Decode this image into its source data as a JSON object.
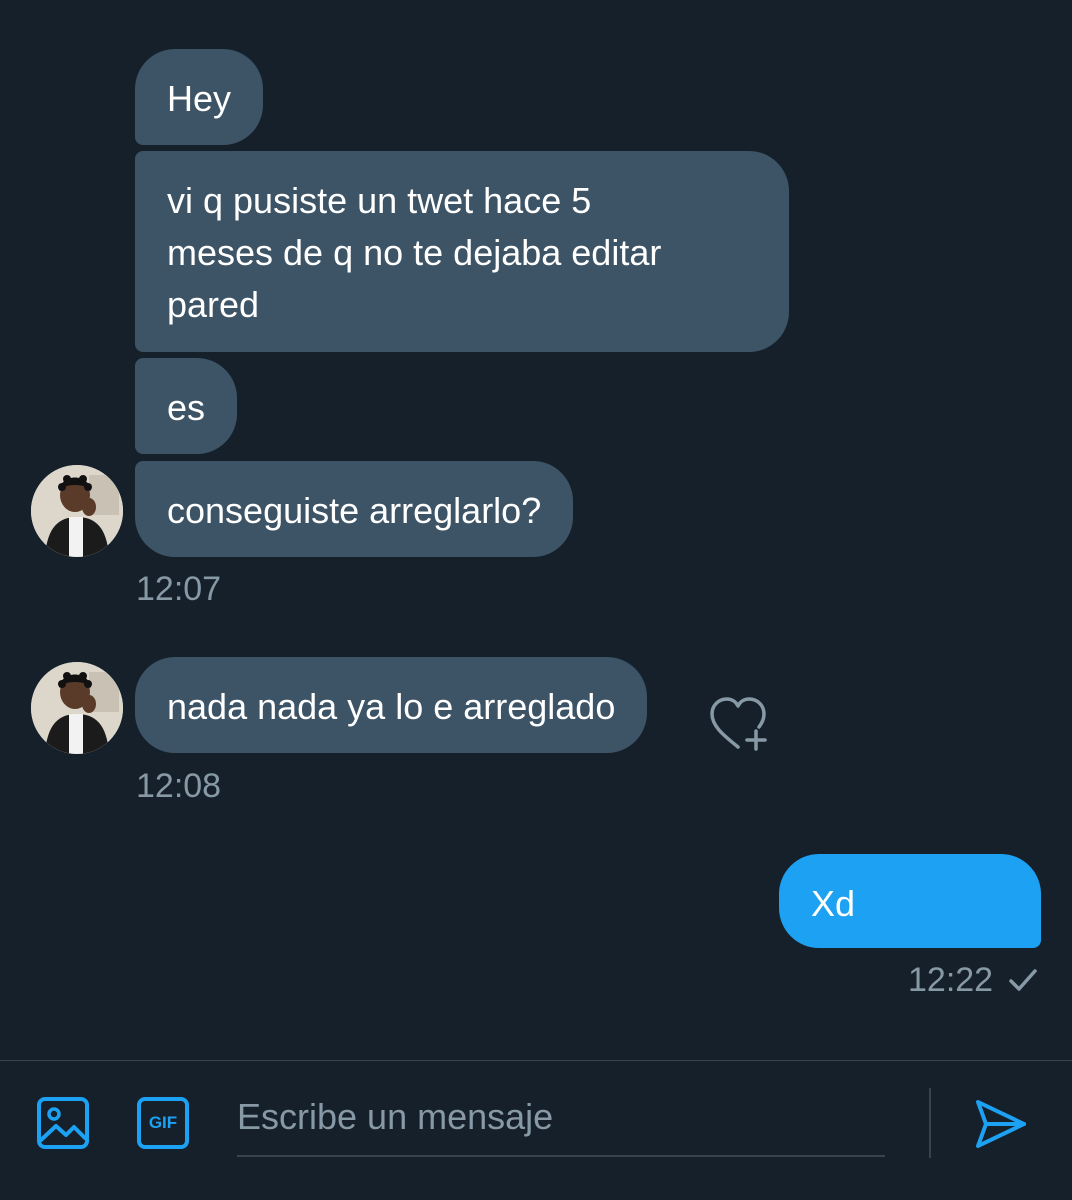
{
  "conversation": {
    "messages": [
      {
        "text": "Hey"
      },
      {
        "text": "vi q pusiste un twet hace 5\nmeses de q no te dejaba editar\npared"
      },
      {
        "text": "es"
      },
      {
        "text": "conseguiste arreglarlo?"
      },
      {
        "text": "nada nada ya lo e arreglado"
      },
      {
        "text": "Xd"
      }
    ],
    "timestamps": {
      "first_group": "12:07",
      "second_group": "12:08",
      "sent": "12:22"
    }
  },
  "icons": {
    "like": "heart-plus-icon",
    "read_receipt": "checkmark-icon",
    "media": "image-icon",
    "gif": "gif-icon",
    "send": "send-icon"
  },
  "gif_label": "GIF",
  "composer": {
    "placeholder": "Escribe un mensaje",
    "value": ""
  },
  "colors": {
    "background": "#15202b",
    "incoming_bubble": "#3d5466",
    "outgoing_bubble": "#1da1f2",
    "accent": "#1da1f2",
    "secondary_text": "#8899a6"
  }
}
